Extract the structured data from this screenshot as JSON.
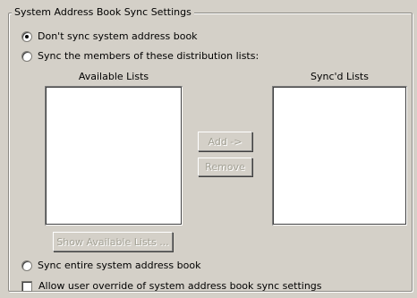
{
  "group": {
    "title": "System Address Book Sync Settings"
  },
  "options": {
    "dont_sync": {
      "label": "Don't sync system address book",
      "checked": true
    },
    "sync_members": {
      "label": "Sync the members of these distribution lists:",
      "checked": false
    },
    "sync_entire": {
      "label": "Sync entire system address book",
      "checked": false
    },
    "allow_override": {
      "label": "Allow user override of system address book sync settings",
      "checked": false
    }
  },
  "available_lists": {
    "label": "Available Lists",
    "items": []
  },
  "synced_lists": {
    "label": "Sync'd Lists",
    "items": []
  },
  "buttons": {
    "add": "Add ->",
    "remove": "Remove",
    "show_available": "Show Available Lists ..."
  }
}
